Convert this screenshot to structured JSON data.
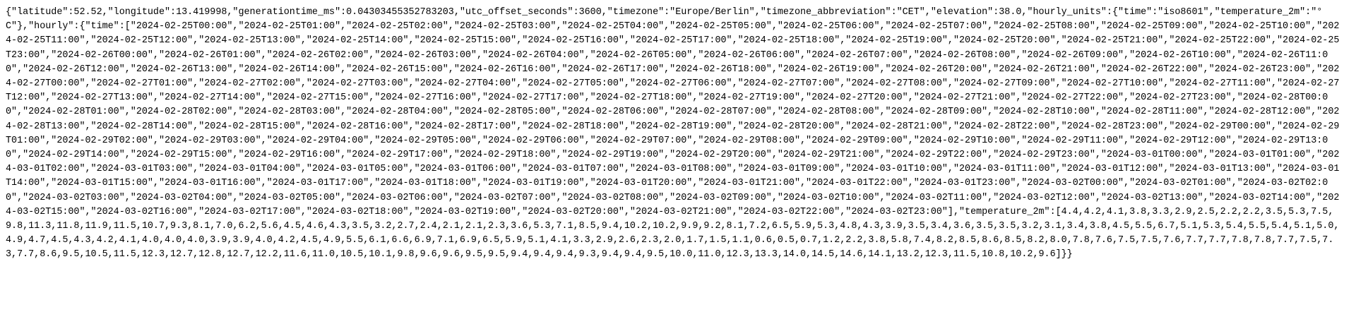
{
  "document": {
    "raw_json": "{\"latitude\":52.52,\"longitude\":13.419998,\"generationtime_ms\":0.04303455352783203,\"utc_offset_seconds\":3600,\"timezone\":\"Europe/Berlin\",\"timezone_abbreviation\":\"CET\",\"elevation\":38.0,\"hourly_units\":{\"time\":\"iso8601\",\"temperature_2m\":\"°C\"},\"hourly\":{\"time\":[\"2024-02-25T00:00\",\"2024-02-25T01:00\",\"2024-02-25T02:00\",\"2024-02-25T03:00\",\"2024-02-25T04:00\",\"2024-02-25T05:00\",\"2024-02-25T06:00\",\"2024-02-25T07:00\",\"2024-02-25T08:00\",\"2024-02-25T09:00\",\"2024-02-25T10:00\",\"2024-02-25T11:00\",\"2024-02-25T12:00\",\"2024-02-25T13:00\",\"2024-02-25T14:00\",\"2024-02-25T15:00\",\"2024-02-25T16:00\",\"2024-02-25T17:00\",\"2024-02-25T18:00\",\"2024-02-25T19:00\",\"2024-02-25T20:00\",\"2024-02-25T21:00\",\"2024-02-25T22:00\",\"2024-02-25T23:00\",\"2024-02-26T00:00\",\"2024-02-26T01:00\",\"2024-02-26T02:00\",\"2024-02-26T03:00\",\"2024-02-26T04:00\",\"2024-02-26T05:00\",\"2024-02-26T06:00\",\"2024-02-26T07:00\",\"2024-02-26T08:00\",\"2024-02-26T09:00\",\"2024-02-26T10:00\",\"2024-02-26T11:00\",\"2024-02-26T12:00\",\"2024-02-26T13:00\",\"2024-02-26T14:00\",\"2024-02-26T15:00\",\"2024-02-26T16:00\",\"2024-02-26T17:00\",\"2024-02-26T18:00\",\"2024-02-26T19:00\",\"2024-02-26T20:00\",\"2024-02-26T21:00\",\"2024-02-26T22:00\",\"2024-02-26T23:00\",\"2024-02-27T00:00\",\"2024-02-27T01:00\",\"2024-02-27T02:00\",\"2024-02-27T03:00\",\"2024-02-27T04:00\",\"2024-02-27T05:00\",\"2024-02-27T06:00\",\"2024-02-27T07:00\",\"2024-02-27T08:00\",\"2024-02-27T09:00\",\"2024-02-27T10:00\",\"2024-02-27T11:00\",\"2024-02-27T12:00\",\"2024-02-27T13:00\",\"2024-02-27T14:00\",\"2024-02-27T15:00\",\"2024-02-27T16:00\",\"2024-02-27T17:00\",\"2024-02-27T18:00\",\"2024-02-27T19:00\",\"2024-02-27T20:00\",\"2024-02-27T21:00\",\"2024-02-27T22:00\",\"2024-02-27T23:00\",\"2024-02-28T00:00\",\"2024-02-28T01:00\",\"2024-02-28T02:00\",\"2024-02-28T03:00\",\"2024-02-28T04:00\",\"2024-02-28T05:00\",\"2024-02-28T06:00\",\"2024-02-28T07:00\",\"2024-02-28T08:00\",\"2024-02-28T09:00\",\"2024-02-28T10:00\",\"2024-02-28T11:00\",\"2024-02-28T12:00\",\"2024-02-28T13:00\",\"2024-02-28T14:00\",\"2024-02-28T15:00\",\"2024-02-28T16:00\",\"2024-02-28T17:00\",\"2024-02-28T18:00\",\"2024-02-28T19:00\",\"2024-02-28T20:00\",\"2024-02-28T21:00\",\"2024-02-28T22:00\",\"2024-02-28T23:00\",\"2024-02-29T00:00\",\"2024-02-29T01:00\",\"2024-02-29T02:00\",\"2024-02-29T03:00\",\"2024-02-29T04:00\",\"2024-02-29T05:00\",\"2024-02-29T06:00\",\"2024-02-29T07:00\",\"2024-02-29T08:00\",\"2024-02-29T09:00\",\"2024-02-29T10:00\",\"2024-02-29T11:00\",\"2024-02-29T12:00\",\"2024-02-29T13:00\",\"2024-02-29T14:00\",\"2024-02-29T15:00\",\"2024-02-29T16:00\",\"2024-02-29T17:00\",\"2024-02-29T18:00\",\"2024-02-29T19:00\",\"2024-02-29T20:00\",\"2024-02-29T21:00\",\"2024-02-29T22:00\",\"2024-02-29T23:00\",\"2024-03-01T00:00\",\"2024-03-01T01:00\",\"2024-03-01T02:00\",\"2024-03-01T03:00\",\"2024-03-01T04:00\",\"2024-03-01T05:00\",\"2024-03-01T06:00\",\"2024-03-01T07:00\",\"2024-03-01T08:00\",\"2024-03-01T09:00\",\"2024-03-01T10:00\",\"2024-03-01T11:00\",\"2024-03-01T12:00\",\"2024-03-01T13:00\",\"2024-03-01T14:00\",\"2024-03-01T15:00\",\"2024-03-01T16:00\",\"2024-03-01T17:00\",\"2024-03-01T18:00\",\"2024-03-01T19:00\",\"2024-03-01T20:00\",\"2024-03-01T21:00\",\"2024-03-01T22:00\",\"2024-03-01T23:00\",\"2024-03-02T00:00\",\"2024-03-02T01:00\",\"2024-03-02T02:00\",\"2024-03-02T03:00\",\"2024-03-02T04:00\",\"2024-03-02T05:00\",\"2024-03-02T06:00\",\"2024-03-02T07:00\",\"2024-03-02T08:00\",\"2024-03-02T09:00\",\"2024-03-02T10:00\",\"2024-03-02T11:00\",\"2024-03-02T12:00\",\"2024-03-02T13:00\",\"2024-03-02T14:00\",\"2024-03-02T15:00\",\"2024-03-02T16:00\",\"2024-03-02T17:00\",\"2024-03-02T18:00\",\"2024-03-02T19:00\",\"2024-03-02T20:00\",\"2024-03-02T21:00\",\"2024-03-02T22:00\",\"2024-03-02T23:00\"],\"temperature_2m\":[4.4,4.2,4.1,3.8,3.3,2.9,2.5,2.2,2.2,3.5,5.3,7.5,9.8,11.3,11.8,11.9,11.5,10.7,9.3,8.1,7.0,6.2,5.6,4.5,4.6,4.3,3.5,3.2,2.7,2.4,2.1,2.1,2.3,3.6,5.3,7.1,8.5,9.4,10.2,10.2,9.9,9.2,8.1,7.2,6.5,5.9,5.3,4.8,4.3,3.9,3.5,3.4,3.6,3.5,3.5,3.2,3.1,3.4,3.8,4.5,5.5,6.7,5.1,5.3,5.4,5.5,5.4,5.1,5.0,4.9,4.7,4.5,4.3,4.2,4.1,4.0,4.0,4.0,3.9,3.9,4.0,4.2,4.5,4.9,5.5,6.1,6.6,6.9,7.1,6.9,6.5,5.9,5.1,4.1,3.3,2.9,2.6,2.3,2.0,1.7,1.5,1.1,0.6,0.5,0.7,1.2,2.2,3.8,5.8,7.4,8.2,8.5,8.6,8.5,8.2,8.0,7.8,7.6,7.5,7.5,7.6,7.7,7.7,7.8,7.8,7.7,7.5,7.3,7.7,8.6,9.5,10.5,11.5,12.3,12.7,12.8,12.7,12.2,11.6,11.0,10.5,10.1,9.8,9.6,9.6,9.5,9.5,9.4,9.4,9.4,9.3,9.4,9.4,9.5,10.0,11.0,12.3,13.3,14.0,14.5,14.6,14.1,13.2,12.3,11.5,10.8,10.2,9.6]}}"
  }
}
